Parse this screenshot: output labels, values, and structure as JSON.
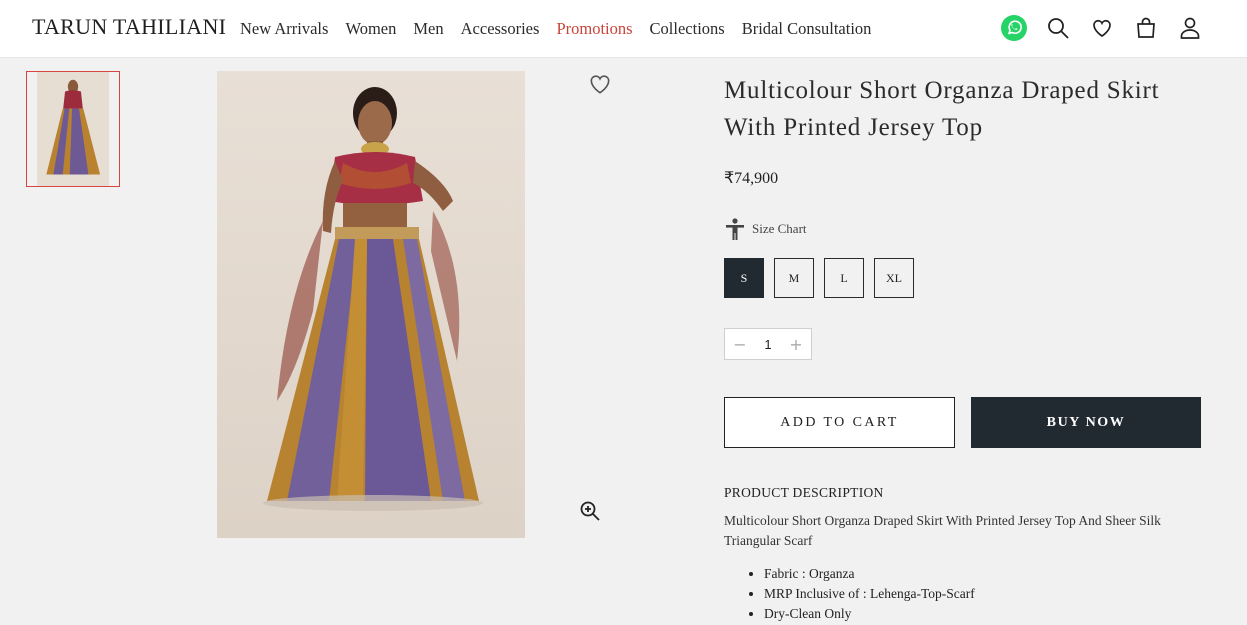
{
  "brand": "TARUN TAHILIANI",
  "nav": [
    {
      "label": "New Arrivals"
    },
    {
      "label": "Women"
    },
    {
      "label": "Men"
    },
    {
      "label": "Accessories"
    },
    {
      "label": "Promotions",
      "highlight": true
    },
    {
      "label": "Collections"
    },
    {
      "label": "Bridal Consultation"
    }
  ],
  "header_icons": [
    "whatsapp-icon",
    "search-icon",
    "heart-icon",
    "bag-icon",
    "user-icon"
  ],
  "colors": {
    "accent": "#c8453a",
    "dark_button": "#222a31",
    "whatsapp": "#25d366"
  },
  "product": {
    "title": "Multicolour Short Organza Draped Skirt With Printed Jersey Top",
    "price": "₹74,900",
    "size_chart_label": "Size Chart",
    "sizes": [
      "S",
      "M",
      "L",
      "XL"
    ],
    "selected_size": "S",
    "quantity": "1",
    "add_to_cart_label": "ADD TO CART",
    "buy_now_label": "BUY NOW",
    "description_heading": "PRODUCT DESCRIPTION",
    "description": "Multicolour Short Organza Draped Skirt With Printed Jersey Top And Sheer Silk Triangular Scarf",
    "details": [
      "Fabric : Organza",
      "MRP Inclusive of : Lehenga-Top-Scarf",
      "Dry-Clean Only"
    ]
  }
}
